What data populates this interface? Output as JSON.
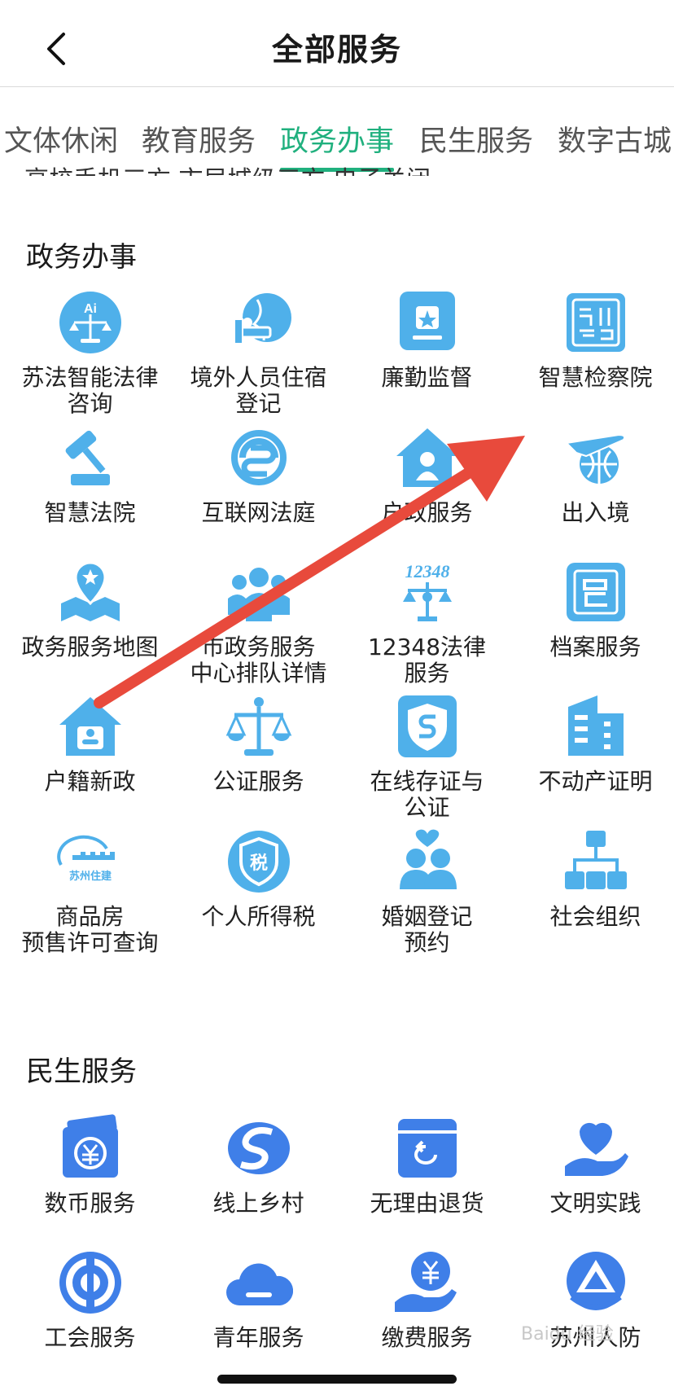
{
  "header": {
    "title": "全部服务"
  },
  "tabs": [
    {
      "label": "文体休闲"
    },
    {
      "label": "教育服务"
    },
    {
      "label": "政务办事"
    },
    {
      "label": "民生服务"
    },
    {
      "label": "数字古城"
    }
  ],
  "cut_row": {
    "text": "高校手机三方    市局城级三方       电子关闭"
  },
  "sections": [
    {
      "title": "政务办事",
      "items": [
        {
          "label": "苏法智能法律\n咨询",
          "icon": "ai-law-scale-icon"
        },
        {
          "label": "境外人员住宿\n登记",
          "icon": "bed-globe-icon"
        },
        {
          "label": "廉勤监督",
          "icon": "star-badge-icon"
        },
        {
          "label": "智慧检察院",
          "icon": "procuratorate-seal-icon"
        },
        {
          "label": "智慧法院",
          "icon": "gavel-icon"
        },
        {
          "label": "互联网法庭",
          "icon": "internet-court-icon"
        },
        {
          "label": "户政服务",
          "icon": "house-user-icon"
        },
        {
          "label": "出入境",
          "icon": "airplane-globe-icon"
        },
        {
          "label": "政务服务地图",
          "icon": "map-pin-icon"
        },
        {
          "label": "市政务服务\n中心排队详情",
          "icon": "people-group-icon"
        },
        {
          "label": "12348法律\n服务",
          "icon": "law-12348-icon"
        },
        {
          "label": "档案服务",
          "icon": "archive-seal-icon"
        },
        {
          "label": "户籍新政",
          "icon": "household-register-icon"
        },
        {
          "label": "公证服务",
          "icon": "balance-scale-icon"
        },
        {
          "label": "在线存证与\n公证",
          "icon": "shield-certificate-icon"
        },
        {
          "label": "不动产证明",
          "icon": "building-icon"
        },
        {
          "label": "商品房\n预售许可查询",
          "icon": "suzhou-jiajian-logo-icon"
        },
        {
          "label": "个人所得税",
          "icon": "tax-shield-icon"
        },
        {
          "label": "婚姻登记\n预约",
          "icon": "couple-heart-icon"
        },
        {
          "label": "社会组织",
          "icon": "org-chart-icon"
        }
      ]
    },
    {
      "title": "民生服务",
      "items": [
        {
          "label": "数币服务",
          "icon": "digital-yuan-wallet-icon"
        },
        {
          "label": "线上乡村",
          "icon": "s-logo-icon"
        },
        {
          "label": "无理由退货",
          "icon": "return-box-icon"
        },
        {
          "label": "文明实践",
          "icon": "heart-hand-icon"
        },
        {
          "label": "工会服务",
          "icon": "trade-union-icon"
        },
        {
          "label": "青年服务",
          "icon": "cloud-icon"
        },
        {
          "label": "缴费服务",
          "icon": "yuan-hand-icon"
        },
        {
          "label": "苏州人防",
          "icon": "civil-defense-icon"
        }
      ]
    }
  ],
  "colors": {
    "accent": "#20b07e",
    "icon_light": "#4fb0ea",
    "icon_dark": "#3f7fe8",
    "arrow": "#e84a3c"
  },
  "watermark": "Baidu 经验"
}
